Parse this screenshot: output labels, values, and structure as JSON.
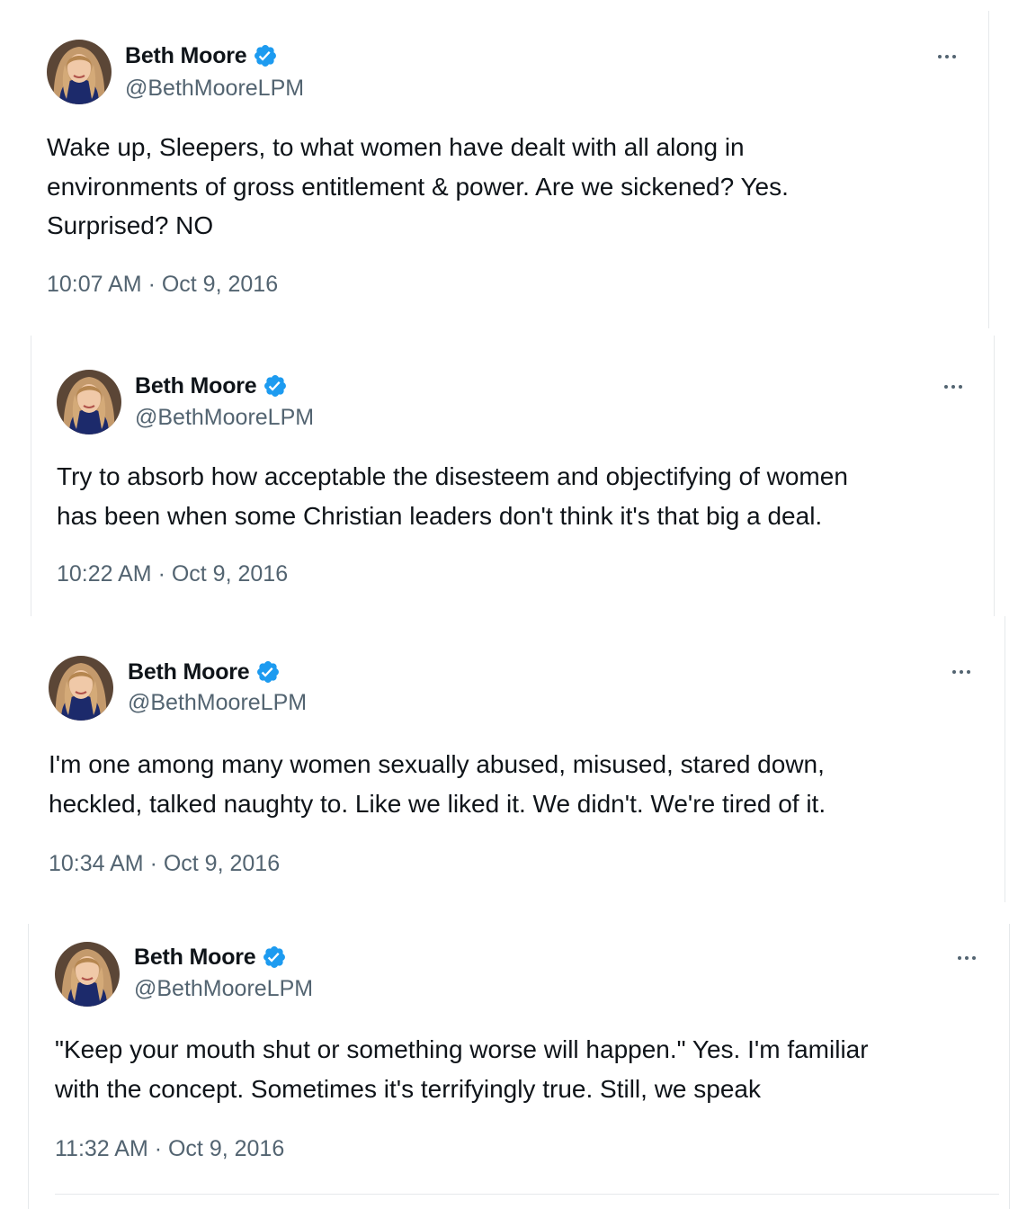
{
  "tweets": [
    {
      "author": "Beth Moore",
      "handle": "@BethMooreLPM",
      "text": "Wake up, Sleepers, to what women have dealt with all along in\nenvironments of gross entitlement & power. Are we sickened? Yes.\nSurprised? NO",
      "timestamp": "10:07 AM · Oct 9, 2016"
    },
    {
      "author": "Beth Moore",
      "handle": "@BethMooreLPM",
      "text": "Try to absorb how acceptable the disesteem and objectifying of women\nhas been when some Christian leaders don't think it's that big a deal.",
      "timestamp": "10:22 AM · Oct 9, 2016"
    },
    {
      "author": "Beth Moore",
      "handle": "@BethMooreLPM",
      "text": "I'm one among many women sexually abused, misused, stared down,\nheckled, talked naughty to. Like we liked it. We didn't. We're tired of it.",
      "timestamp": "10:34 AM · Oct 9, 2016"
    },
    {
      "author": "Beth Moore",
      "handle": "@BethMooreLPM",
      "text": "\"Keep your mouth shut or something worse will happen.\" Yes. I'm familiar\nwith the concept. Sometimes it's terrifyingly true. Still, we speak",
      "timestamp": "11:32 AM · Oct 9, 2016"
    }
  ],
  "icons": {
    "verified_badge": "verified-badge-icon",
    "more_menu": "more-options-icon"
  },
  "colors": {
    "verified_blue": "#1d9bf0",
    "secondary_text": "#536471",
    "primary_text": "#0f1419",
    "border": "#e6e9eb"
  }
}
